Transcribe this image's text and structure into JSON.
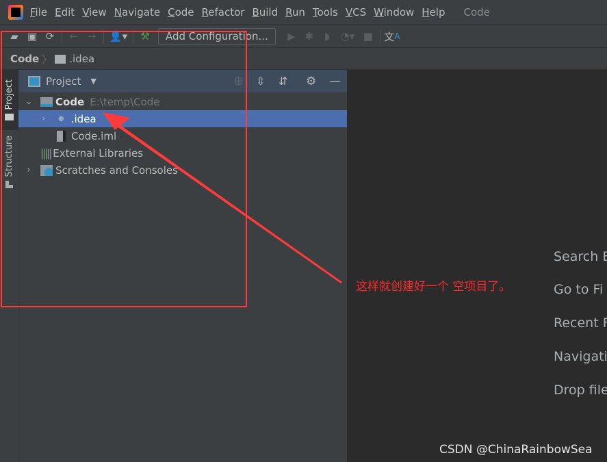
{
  "menubar": {
    "items": [
      "File",
      "Edit",
      "View",
      "Navigate",
      "Code",
      "Refactor",
      "Build",
      "Run",
      "Tools",
      "VCS",
      "Window",
      "Help"
    ],
    "window_title": "Code"
  },
  "toolbar": {
    "add_configuration": "Add Configuration..."
  },
  "breadcrumb": {
    "root": "Code",
    "child": ".idea"
  },
  "stripe": {
    "project": "Project",
    "structure": "Structure"
  },
  "panel": {
    "title": "Project",
    "tree": [
      {
        "label": "Code",
        "path": "E:\\temp\\Code"
      },
      {
        "label": ".idea"
      },
      {
        "label": "Code.iml"
      },
      {
        "label": "External Libraries"
      },
      {
        "label": "Scratches and Consoles"
      }
    ]
  },
  "editor": {
    "hints": [
      "Search E",
      "Go to Fi",
      "Recent F",
      "Navigati",
      "Drop file"
    ]
  },
  "annotation": "这样就创建好一个 空项目了。",
  "watermark": "CSDN @ChinaRainbowSea",
  "colors": {
    "selection": "#4b6eaf",
    "annotation": "#ff3b3b",
    "editor_bg": "#2b2b2b"
  }
}
